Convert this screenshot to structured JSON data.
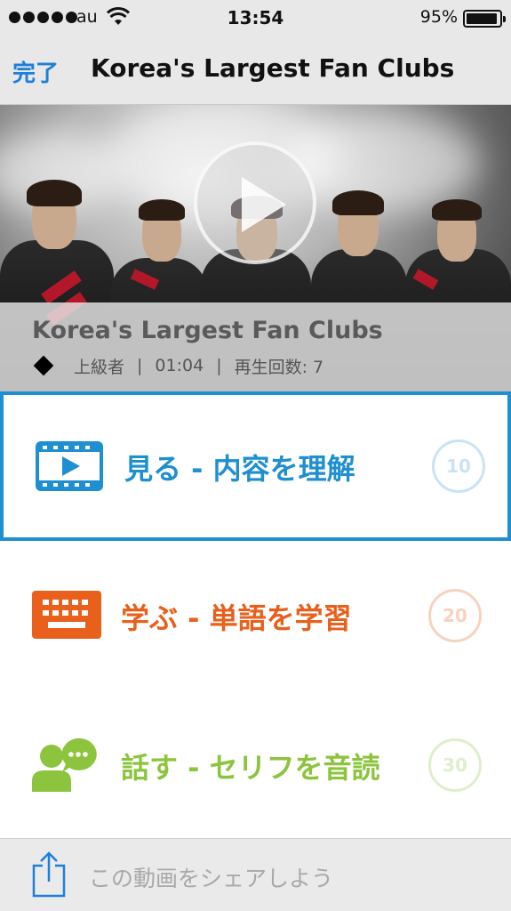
{
  "status_bar": {
    "carrier": "au",
    "time": "13:54",
    "battery_percent": "95%",
    "battery_level": 0.95,
    "signal_bars": 5
  },
  "nav": {
    "done_label": "完了",
    "title": "Korea's Largest Fan Clubs"
  },
  "video": {
    "title": "Korea's Largest Fan Clubs",
    "level": "上級者",
    "separator": "|",
    "duration": "01:04",
    "play_count": "再生回数: 7"
  },
  "menu": [
    {
      "label": "見る - 内容を理解",
      "count": "10",
      "color": "#1e8fd0",
      "circle_color": "#c8e3f5",
      "icon": "video-icon",
      "selected": true
    },
    {
      "label": "学ぶ - 単語を学習",
      "count": "20",
      "color": "#e8601c",
      "circle_color": "#f8d2bf",
      "icon": "keyboard-icon",
      "selected": false
    },
    {
      "label": "話す - セリフを音読",
      "count": "30",
      "color": "#8cc43d",
      "circle_color": "#dfeecb",
      "icon": "speech-person-icon",
      "selected": false
    }
  ],
  "share": {
    "label": "この動画をシェアしよう",
    "icon": "share-icon"
  }
}
